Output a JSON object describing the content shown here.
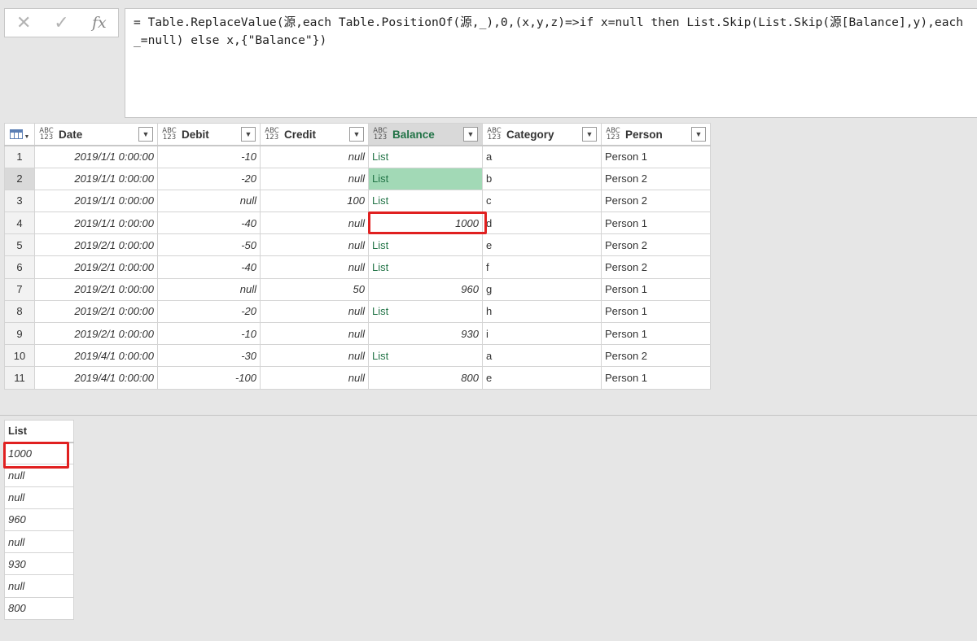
{
  "formula_bar": {
    "cancel_icon": "close-icon",
    "confirm_icon": "check-icon",
    "fx_label": "fx",
    "formula": "= Table.ReplaceValue(源,each Table.PositionOf(源,_),0,(x,y,z)=>if x=null then List.Skip(List.Skip(源[Balance],y),each _=null) else x,{\"Balance\"})"
  },
  "grid": {
    "type_icon_top": "ABC",
    "type_icon_bottom": "123",
    "columns": [
      "Date",
      "Debit",
      "Credit",
      "Balance",
      "Category",
      "Person"
    ],
    "selected_column": "Balance",
    "selected_row": 2,
    "rows": [
      {
        "n": "1",
        "date": "2019/1/1 0:00:00",
        "debit": "-10",
        "credit": "null",
        "balance": "List",
        "category": "a",
        "person": "Person 1"
      },
      {
        "n": "2",
        "date": "2019/1/1 0:00:00",
        "debit": "-20",
        "credit": "null",
        "balance": "List",
        "category": "b",
        "person": "Person 2"
      },
      {
        "n": "3",
        "date": "2019/1/1 0:00:00",
        "debit": "null",
        "credit": "100",
        "balance": "List",
        "category": "c",
        "person": "Person 2"
      },
      {
        "n": "4",
        "date": "2019/1/1 0:00:00",
        "debit": "-40",
        "credit": "null",
        "balance": "1000",
        "category": "d",
        "person": "Person 1"
      },
      {
        "n": "5",
        "date": "2019/2/1 0:00:00",
        "debit": "-50",
        "credit": "null",
        "balance": "List",
        "category": "e",
        "person": "Person 2"
      },
      {
        "n": "6",
        "date": "2019/2/1 0:00:00",
        "debit": "-40",
        "credit": "null",
        "balance": "List",
        "category": "f",
        "person": "Person 2"
      },
      {
        "n": "7",
        "date": "2019/2/1 0:00:00",
        "debit": "null",
        "credit": "50",
        "balance": "960",
        "category": "g",
        "person": "Person 1"
      },
      {
        "n": "8",
        "date": "2019/2/1 0:00:00",
        "debit": "-20",
        "credit": "null",
        "balance": "List",
        "category": "h",
        "person": "Person 1"
      },
      {
        "n": "9",
        "date": "2019/2/1 0:00:00",
        "debit": "-10",
        "credit": "null",
        "balance": "930",
        "category": "i",
        "person": "Person 1"
      },
      {
        "n": "10",
        "date": "2019/4/1 0:00:00",
        "debit": "-30",
        "credit": "null",
        "balance": "List",
        "category": "a",
        "person": "Person 2"
      },
      {
        "n": "11",
        "date": "2019/4/1 0:00:00",
        "debit": "-100",
        "credit": "null",
        "balance": "800",
        "category": "e",
        "person": "Person 1"
      }
    ]
  },
  "list_preview": {
    "header": "List",
    "values": [
      "1000",
      "null",
      "null",
      "960",
      "null",
      "930",
      "null",
      "800"
    ]
  },
  "colors": {
    "list_text": "#217346",
    "selected_cell": "#a2d9b6",
    "highlight_box": "#e02020"
  }
}
